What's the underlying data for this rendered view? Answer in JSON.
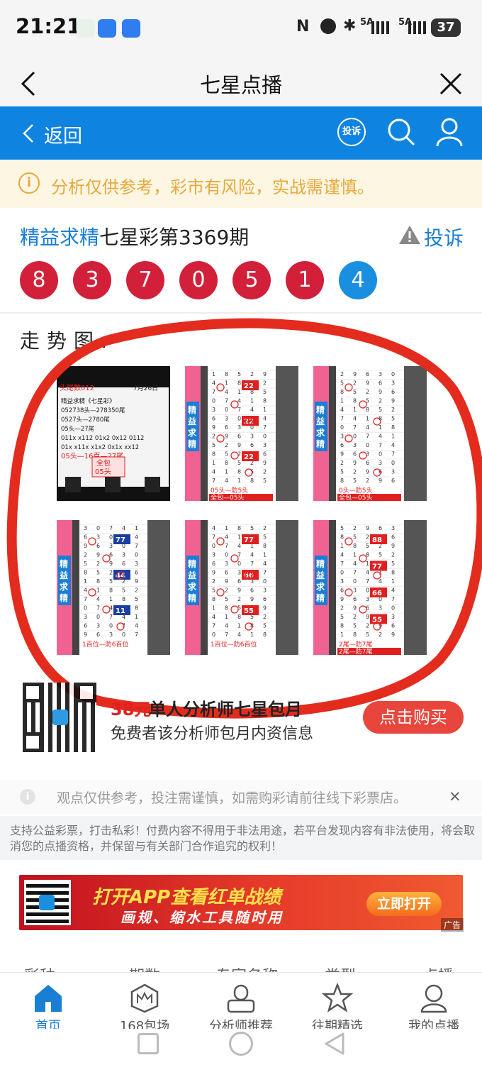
{
  "status_bar": {
    "time": "21:21",
    "network_1": "5A",
    "network_2": "5A",
    "battery": "37"
  },
  "title_bar": {
    "title": "七星点播"
  },
  "nav_bar": {
    "back_label": "返回",
    "report_icon_label": "投诉"
  },
  "notice": {
    "text": "分析仅供参考，彩市有风险，实战需谨慎。"
  },
  "header": {
    "brand": "精益求精",
    "issue_title": "七星彩第3369期",
    "report_label": "投诉"
  },
  "balls": [
    {
      "value": "8",
      "color": "#d3203a"
    },
    {
      "value": "3",
      "color": "#d3203a"
    },
    {
      "value": "7",
      "color": "#d3203a"
    },
    {
      "value": "0",
      "color": "#d3203a"
    },
    {
      "value": "5",
      "color": "#d3203a"
    },
    {
      "value": "1",
      "color": "#d3203a"
    },
    {
      "value": "4",
      "color": "#1a8fe0"
    }
  ],
  "trend_label": "走势图:",
  "charts": [
    {
      "id": 1,
      "title": "头尾数012",
      "date": "7月26日",
      "lines": [
        "精益求精《七星彩》",
        "052738头—278350尾",
        "0527头—2780尾",
        "05头—27尾",
        "011x x112 01x2 0x12 0112",
        "01x x11x x1x2 0x1x xx12",
        "05头—16百—27尾"
      ],
      "badge": "全包",
      "badge2": "05头"
    },
    {
      "id": 2,
      "side_label": "精益求精",
      "tags": [
        "22",
        "22",
        "22"
      ],
      "bottom_1": "05头—防5头",
      "bottom_2": "全包—05头"
    },
    {
      "id": 3,
      "side_label": "精益求精",
      "bottom_1": "0头—防5头",
      "bottom_2": "全包—05头"
    },
    {
      "id": 4,
      "side_label": "精益求精",
      "tags": [
        "77",
        "44",
        "11"
      ],
      "bottom_1": "1百位—防6百位"
    },
    {
      "id": 5,
      "side_label": "精益求精",
      "tags": [
        "77",
        "66",
        "55"
      ],
      "bottom_1": "1百位—防6百位"
    },
    {
      "id": 6,
      "side_label": "精益求精",
      "tags": [
        "88",
        "77",
        "66",
        "55"
      ],
      "bottom_1": "2尾—防7尾",
      "bottom_2": "2尾—防7尾"
    }
  ],
  "promo": {
    "price": "38元",
    "title": "单人分析师七星包月",
    "subtitle": "免费者该分析师包月内资信息",
    "buy_label": "点击购买"
  },
  "tip": {
    "text": "观点仅供参考，投注需谨慎，如需购彩请前往线下彩票店。",
    "close": "×"
  },
  "disclaimer": "支持公益彩票，打击私彩！付费内容不得用于非法用途，若平台发现内容有非法使用，将会取消您的点播资格，并保留与有关部门合作追究的权利！",
  "banner": {
    "title": "打开APP查看红单战绩",
    "subtitle": "画规、缩水工具随时用",
    "button": "立即打开",
    "ad_label": "广告"
  },
  "table_head": [
    "彩种",
    "期数",
    "专家名称",
    "类型",
    "点播"
  ],
  "bottom_nav": [
    {
      "label": "首页",
      "icon": "home-icon",
      "active": true
    },
    {
      "label": "168包场",
      "icon": "crown-icon",
      "active": false
    },
    {
      "label": "分析师推荐",
      "icon": "analyst-icon",
      "active": false
    },
    {
      "label": "往期精选",
      "icon": "star-icon",
      "active": false
    },
    {
      "label": "我的点播",
      "icon": "user-icon",
      "active": false
    }
  ],
  "colors": {
    "brand_blue": "#0e84e0",
    "red": "#d3203a",
    "warning": "#e8a83d"
  }
}
